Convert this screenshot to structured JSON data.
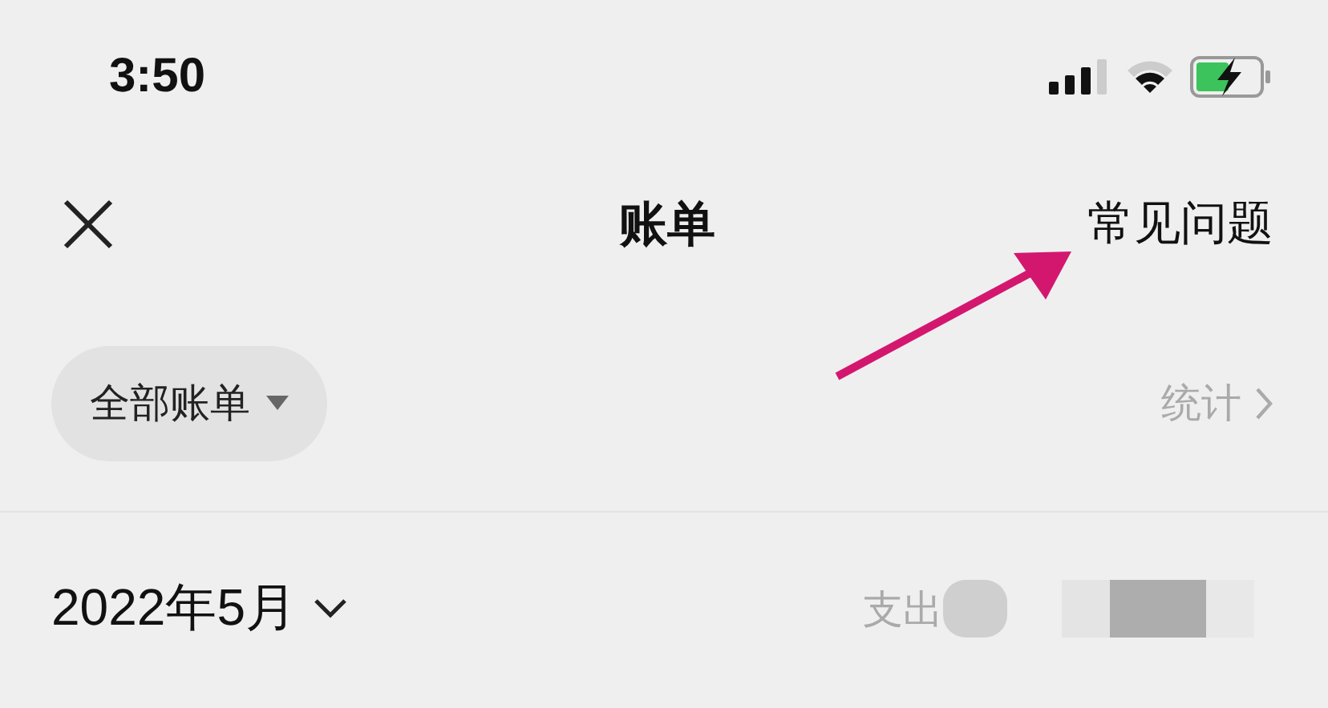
{
  "status_bar": {
    "time": "3:50"
  },
  "nav": {
    "title": "账单",
    "action": "常见问题"
  },
  "filter": {
    "label": "全部账单",
    "stats_link": "统计"
  },
  "month_row": {
    "month": "2022年5月",
    "expense_label": "支出"
  },
  "annotation": {
    "kind": "arrow",
    "color": "#d3176f"
  }
}
